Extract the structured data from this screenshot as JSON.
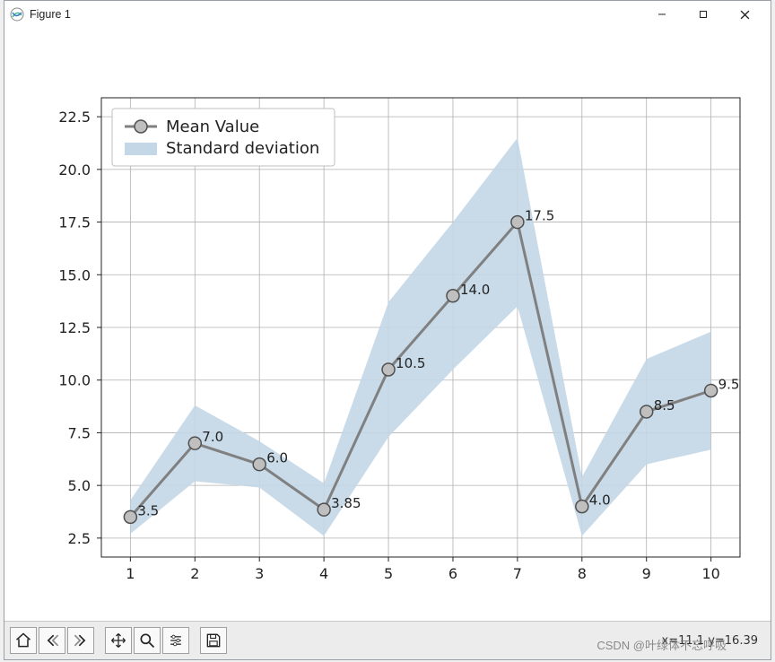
{
  "window": {
    "title": "Figure 1"
  },
  "toolbar_status": {
    "coords": "x=11.1 y=16.39"
  },
  "watermark": "CSDN @叶绿体不忘呼吸",
  "chart_data": {
    "type": "line",
    "x": [
      1,
      2,
      3,
      4,
      5,
      6,
      7,
      8,
      9,
      10
    ],
    "values": [
      3.5,
      7.0,
      6.0,
      3.85,
      10.5,
      14.0,
      17.5,
      4.0,
      8.5,
      9.5
    ],
    "point_labels": [
      "3.5",
      "7.0",
      "6.0",
      "3.85",
      "10.5",
      "14.0",
      "17.5",
      "4.0",
      "8.5",
      "9.5"
    ],
    "std_upper": [
      4.3,
      8.8,
      7.1,
      5.1,
      13.7,
      17.5,
      21.5,
      5.4,
      11.0,
      12.3
    ],
    "std_lower": [
      2.7,
      5.2,
      4.9,
      2.6,
      7.3,
      10.5,
      13.5,
      2.6,
      6.0,
      6.7
    ],
    "xticks": [
      1,
      2,
      3,
      4,
      5,
      6,
      7,
      8,
      9,
      10
    ],
    "yticks": [
      2.5,
      5.0,
      7.5,
      10.0,
      12.5,
      15.0,
      17.5,
      20.0,
      22.5
    ],
    "ytick_labels": [
      "2.5",
      "5.0",
      "7.5",
      "10.0",
      "12.5",
      "15.0",
      "17.5",
      "20.0",
      "22.5"
    ],
    "xlim": [
      0.55,
      10.45
    ],
    "ylim": [
      1.6,
      23.4
    ],
    "legend": {
      "line_label": "Mean Value",
      "band_label": "Standard deviation"
    },
    "line_color": "#808080",
    "marker_face": "#bfbfbf",
    "marker_edge": "#505050",
    "band_color": "#c3d7e7"
  }
}
